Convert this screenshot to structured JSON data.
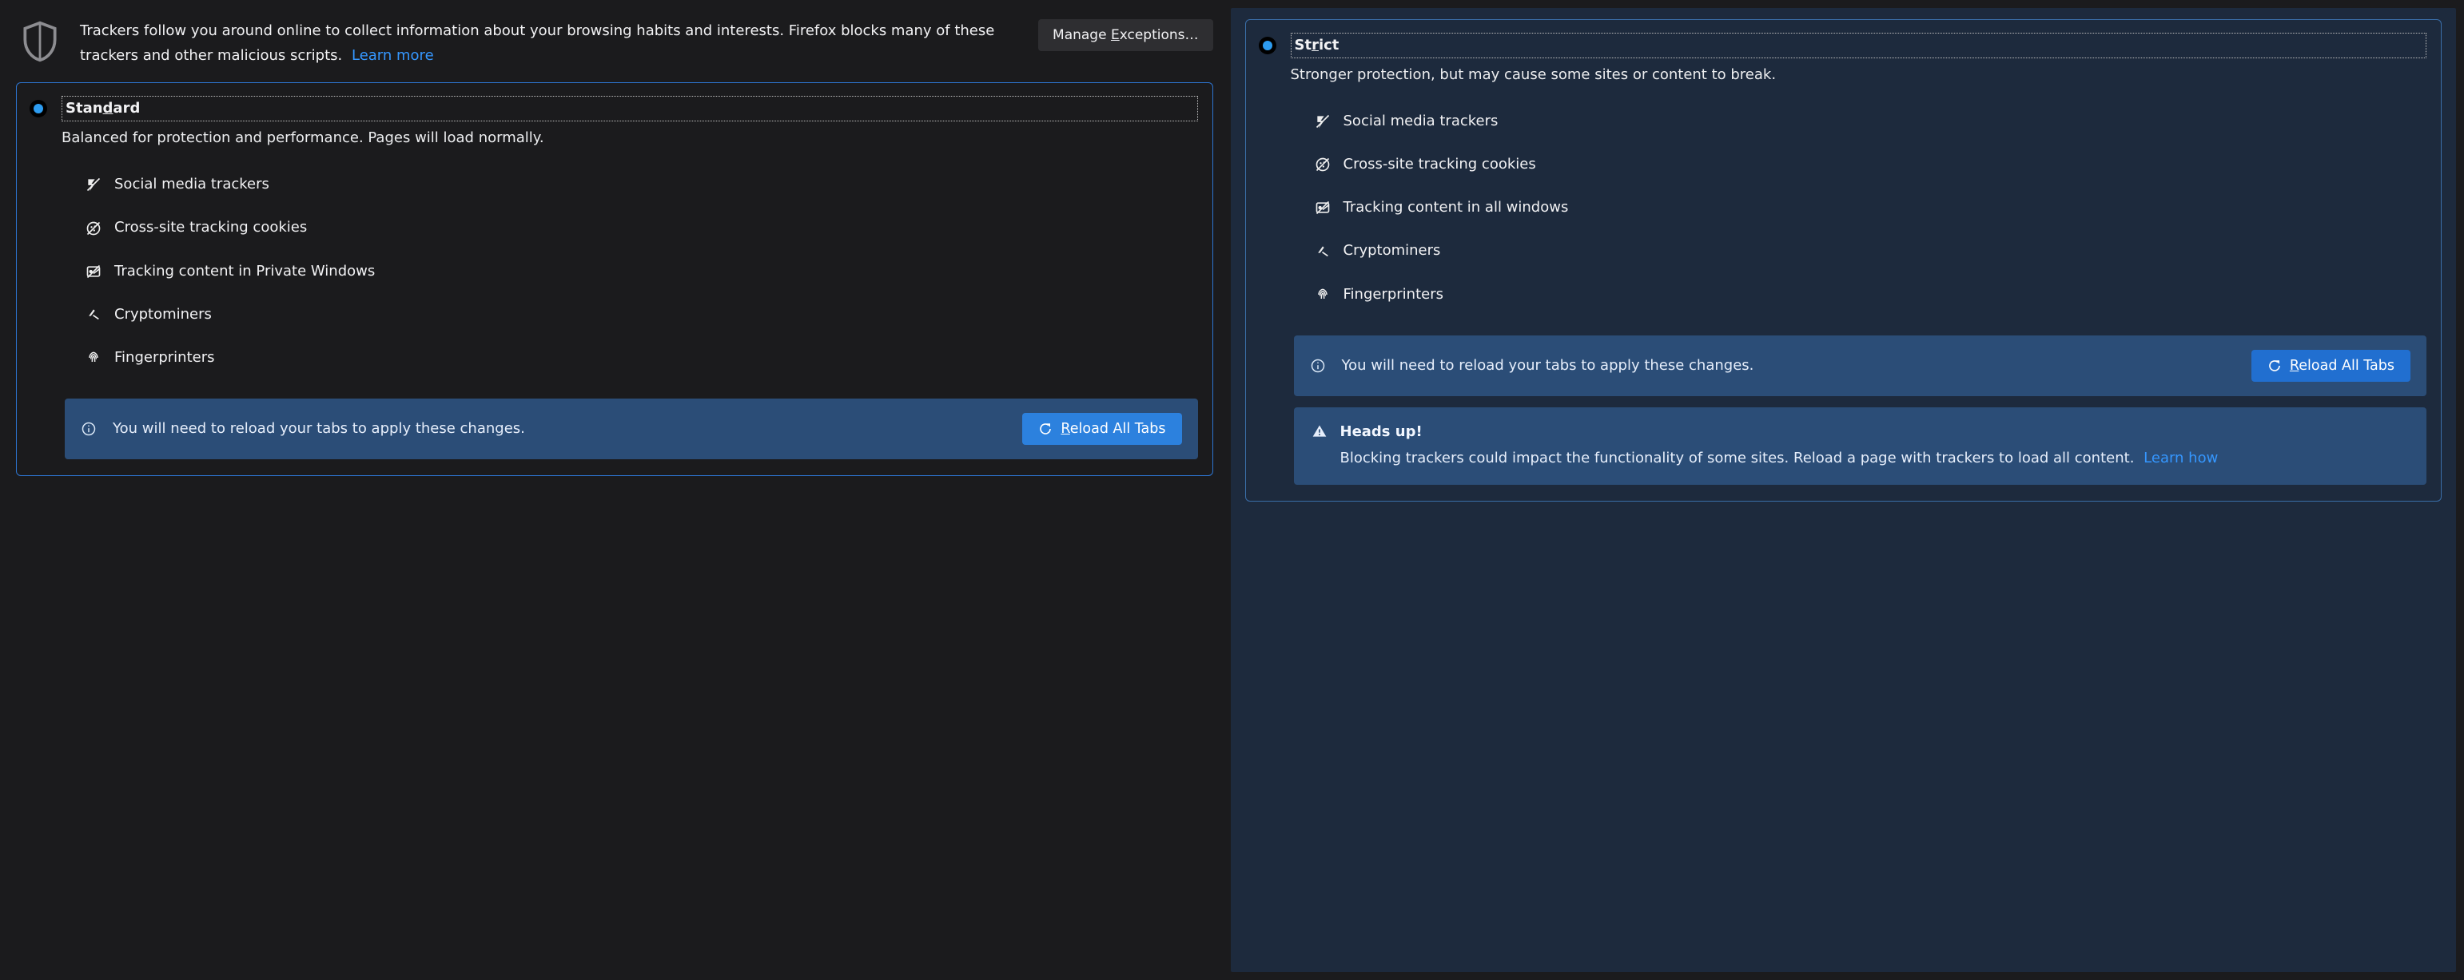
{
  "intro": {
    "text": "Trackers follow you around online to collect information about your browsing habits and interests. Firefox blocks many of these trackers and other malicious scripts.",
    "learn_more": "Learn more",
    "manage_exceptions": "Manage Exceptions…"
  },
  "standard": {
    "title": "Standard",
    "desc": "Balanced for protection and performance. Pages will load normally.",
    "items": [
      "Social media trackers",
      "Cross-site tracking cookies",
      "Tracking content in Private Windows",
      "Cryptominers",
      "Fingerprinters"
    ],
    "notice": "You will need to reload your tabs to apply these changes.",
    "reload_btn": "Reload All Tabs"
  },
  "strict": {
    "title": "Strict",
    "desc": "Stronger protection, but may cause some sites or content to break.",
    "items": [
      "Social media trackers",
      "Cross-site tracking cookies",
      "Tracking content in all windows",
      "Cryptominers",
      "Fingerprinters"
    ],
    "notice": "You will need to reload your tabs to apply these changes.",
    "reload_btn": "Reload All Tabs",
    "heads_title": "Heads up!",
    "heads_body": "Blocking trackers could impact the functionality of some sites. Reload a page with trackers to load all content.",
    "learn_how": "Learn how"
  }
}
